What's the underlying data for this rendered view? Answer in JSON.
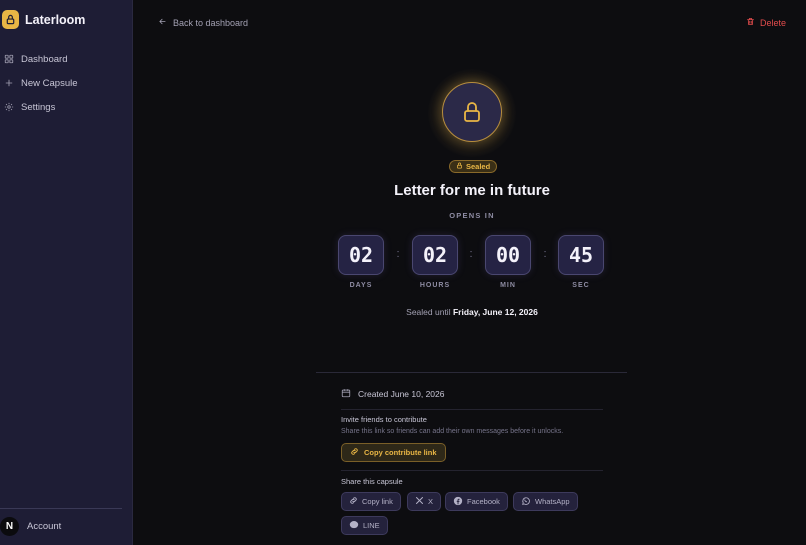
{
  "app": {
    "name": "Laterloom"
  },
  "sidebar": {
    "items": [
      {
        "label": "Dashboard",
        "icon": "grid-icon"
      },
      {
        "label": "New Capsule",
        "icon": "plus-icon"
      },
      {
        "label": "Settings",
        "icon": "gear-icon"
      }
    ],
    "account": {
      "label": "Account",
      "avatar_letter": "N"
    }
  },
  "header": {
    "back_label": "Back to dashboard",
    "delete_label": "Delete"
  },
  "capsule": {
    "status": "Sealed",
    "title": "Letter for me in future",
    "opens_in_label": "OPENS IN",
    "countdown": [
      {
        "value": "02",
        "unit": "DAYS"
      },
      {
        "value": "02",
        "unit": "HOURS"
      },
      {
        "value": "00",
        "unit": "MIN"
      },
      {
        "value": "45",
        "unit": "SEC"
      }
    ],
    "separator": ":",
    "sealed_until_prefix": "Sealed until",
    "sealed_until_date": "Friday, June 12, 2026"
  },
  "details": {
    "created": "Created June 10, 2026",
    "invite_title": "Invite friends to contribute",
    "invite_desc": "Share this link so friends can add their own messages before it unlocks.",
    "contribute_button": "Copy contribute link",
    "share_title": "Share this capsule",
    "share_buttons": [
      {
        "label": "Copy link",
        "icon": "link-icon"
      },
      {
        "label": "X",
        "icon": "x-logo-icon"
      },
      {
        "label": "Facebook",
        "icon": "facebook-icon"
      },
      {
        "label": "WhatsApp",
        "icon": "whatsapp-icon"
      },
      {
        "label": "LINE",
        "icon": "line-icon"
      }
    ]
  },
  "colors": {
    "accent": "#e9b645",
    "danger": "#e24c4c",
    "sidebar_bg": "#1e1d35",
    "page_bg": "#0d0d10"
  }
}
